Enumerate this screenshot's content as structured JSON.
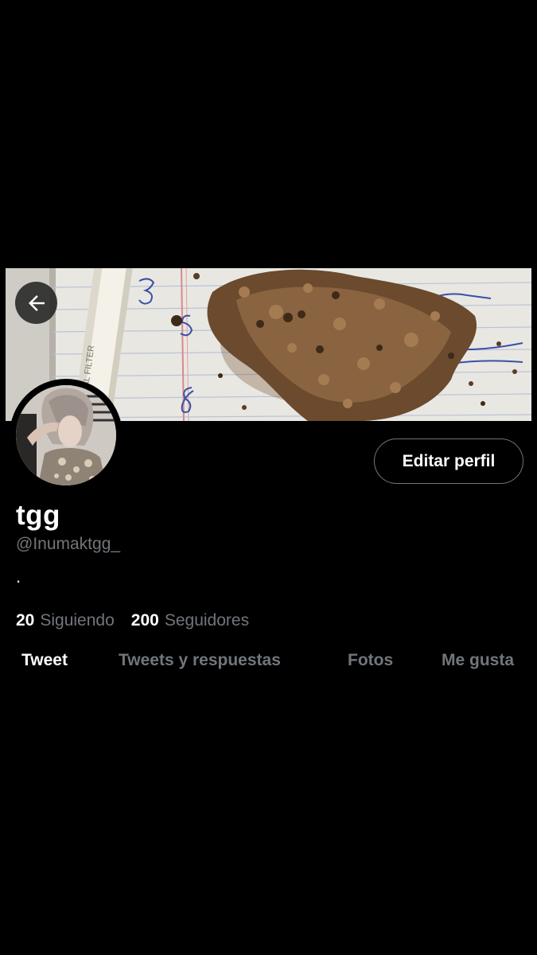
{
  "header": {
    "back_icon": "arrow-left-icon"
  },
  "banner": {
    "description_icon": "cover-photo",
    "handwriting": [
      "3",
      "5",
      "8"
    ],
    "filter_text": "AL FILTER"
  },
  "profile": {
    "display_name": "tgg",
    "handle": "@Inumaktgg_",
    "bio": ".",
    "edit_label": "Editar perfil",
    "following_count": "20",
    "following_label": "Siguiendo",
    "followers_count": "200",
    "followers_label": "Seguidores"
  },
  "tabs": [
    {
      "label": "Tweet",
      "active": true
    },
    {
      "label": "Tweets y respuestas",
      "active": false
    },
    {
      "label": "Fotos",
      "active": false
    },
    {
      "label": "Me gusta",
      "active": false
    }
  ],
  "colors": {
    "background": "#000000",
    "text_primary": "#ffffff",
    "text_secondary": "#71767b",
    "button_border": "#6e767d"
  }
}
